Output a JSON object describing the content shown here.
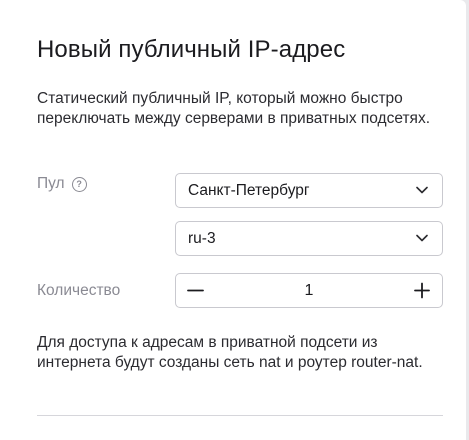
{
  "dialog": {
    "title": "Новый публичный IP-адрес",
    "description": "Статический публичный IP, который можно быстро переключать между серверами в приватных подсетях."
  },
  "form": {
    "pool": {
      "label": "Пул",
      "help_icon": "question-circle-icon",
      "region_value": "Санкт-Петербург",
      "zone_value": "ru-3"
    },
    "quantity": {
      "label": "Количество",
      "value": "1",
      "minus_icon": "minus-icon",
      "plus_icon": "plus-icon"
    }
  },
  "note": "Для доступа к адресам в приватной подсети из интернета будут созданы сеть nat и роутер router-nat."
}
